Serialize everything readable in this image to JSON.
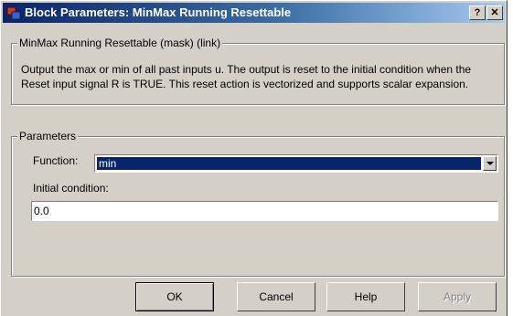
{
  "window": {
    "title": "Block Parameters: MinMax Running Resettable",
    "help_glyph": "?",
    "close_glyph": "✕"
  },
  "mask_group": {
    "legend": "MinMax Running Resettable (mask) (link)",
    "description": "Output the max or min of all past inputs u.  The output is reset to the initial condition when the Reset input signal R is TRUE.  This reset action is vectorized and supports scalar expansion."
  },
  "parameters": {
    "legend": "Parameters",
    "function_label": "Function:",
    "function_value": "min",
    "initial_condition_label": "Initial condition:",
    "initial_condition_value": "0.0"
  },
  "buttons": {
    "ok": "OK",
    "cancel": "Cancel",
    "help": "Help",
    "apply": "Apply"
  },
  "colors": {
    "title_start": "#0a246a",
    "title_end": "#a6caf0",
    "selection": "#0a246a",
    "face": "#d4d0c8"
  }
}
